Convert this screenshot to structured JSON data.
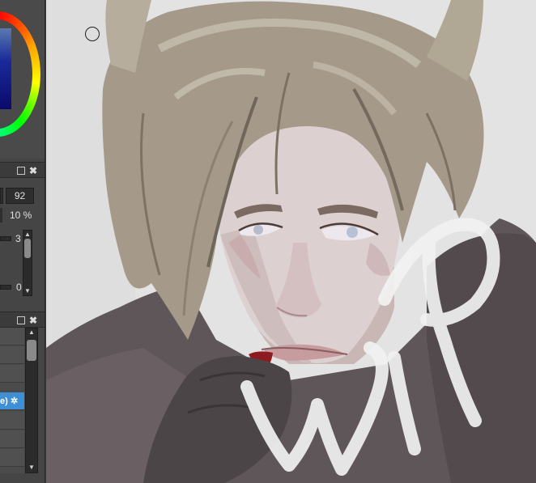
{
  "tool_panel": {
    "size_value": "92",
    "opacity_value": "10 %",
    "slider_top_value": "3",
    "slider_bottom_value": "0"
  },
  "layers_panel": {
    "selected_layer_label": "e)"
  },
  "canvas": {
    "watermark_text": "WiP",
    "background_color": "#e4e4e4"
  }
}
